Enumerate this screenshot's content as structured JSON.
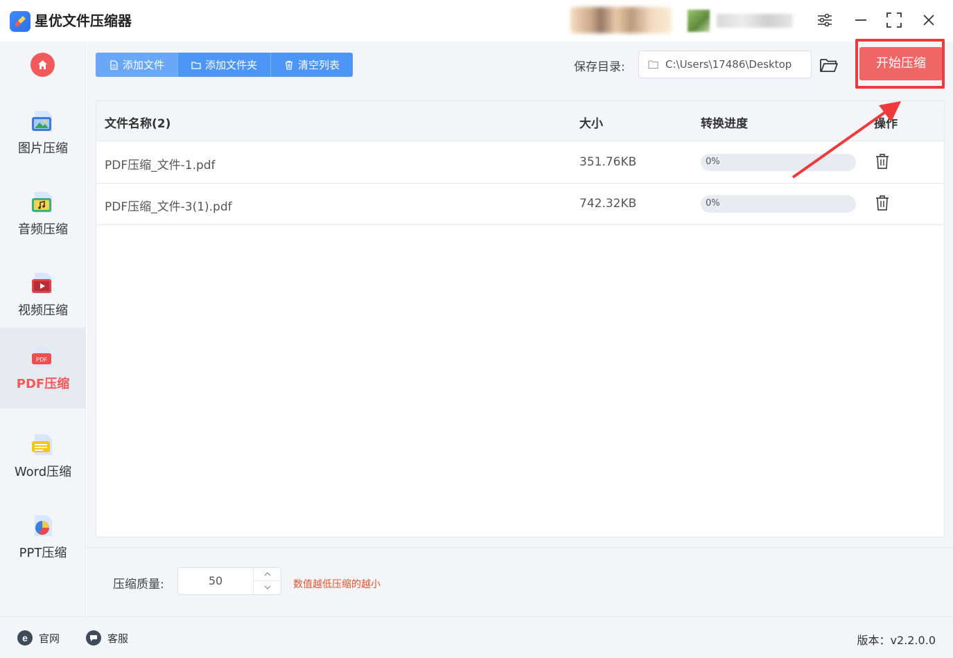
{
  "app": {
    "title": "星优文件压缩器"
  },
  "window_controls": {
    "settings_icon": "sliders-icon",
    "minimize_icon": "minimize-icon",
    "maximize_icon": "maximize-icon",
    "close_icon": "close-icon"
  },
  "sidebar": {
    "items": [
      {
        "label": "图片压缩",
        "icon": "image-file-icon",
        "active": false
      },
      {
        "label": "音频压缩",
        "icon": "audio-file-icon",
        "active": false
      },
      {
        "label": "视频压缩",
        "icon": "video-file-icon",
        "active": false
      },
      {
        "label": "PDF压缩",
        "icon": "pdf-file-icon",
        "active": true
      },
      {
        "label": "Word压缩",
        "icon": "word-file-icon",
        "active": false
      },
      {
        "label": "PPT压缩",
        "icon": "ppt-file-icon",
        "active": false
      }
    ]
  },
  "toolbar": {
    "add_file": "添加文件",
    "add_folder": "添加文件夹",
    "clear_list": "清空列表",
    "save_dir_label": "保存目录:",
    "save_dir_value": "C:\\Users\\17486\\Desktop",
    "start_button": "开始压缩"
  },
  "table": {
    "headers": {
      "name": "文件名称(2)",
      "size": "大小",
      "progress": "转换进度",
      "action": "操作"
    },
    "rows": [
      {
        "name": "PDF压缩_文件-1.pdf",
        "size": "351.76KB",
        "progress_text": "0%",
        "progress": 0
      },
      {
        "name": "PDF压缩_文件-3(1).pdf",
        "size": "742.32KB",
        "progress_text": "0%",
        "progress": 0
      }
    ]
  },
  "settings": {
    "quality_label": "压缩质量:",
    "quality_value": "50",
    "quality_hint": "数值越低压缩的越小"
  },
  "footer": {
    "website": "官网",
    "support": "客服",
    "version": "版本：v2.2.0.0"
  },
  "colors": {
    "accent_blue": "#4d96f5",
    "accent_red": "#f06565",
    "highlight_red": "#ee3a3a",
    "hint_orange": "#e0532f"
  }
}
